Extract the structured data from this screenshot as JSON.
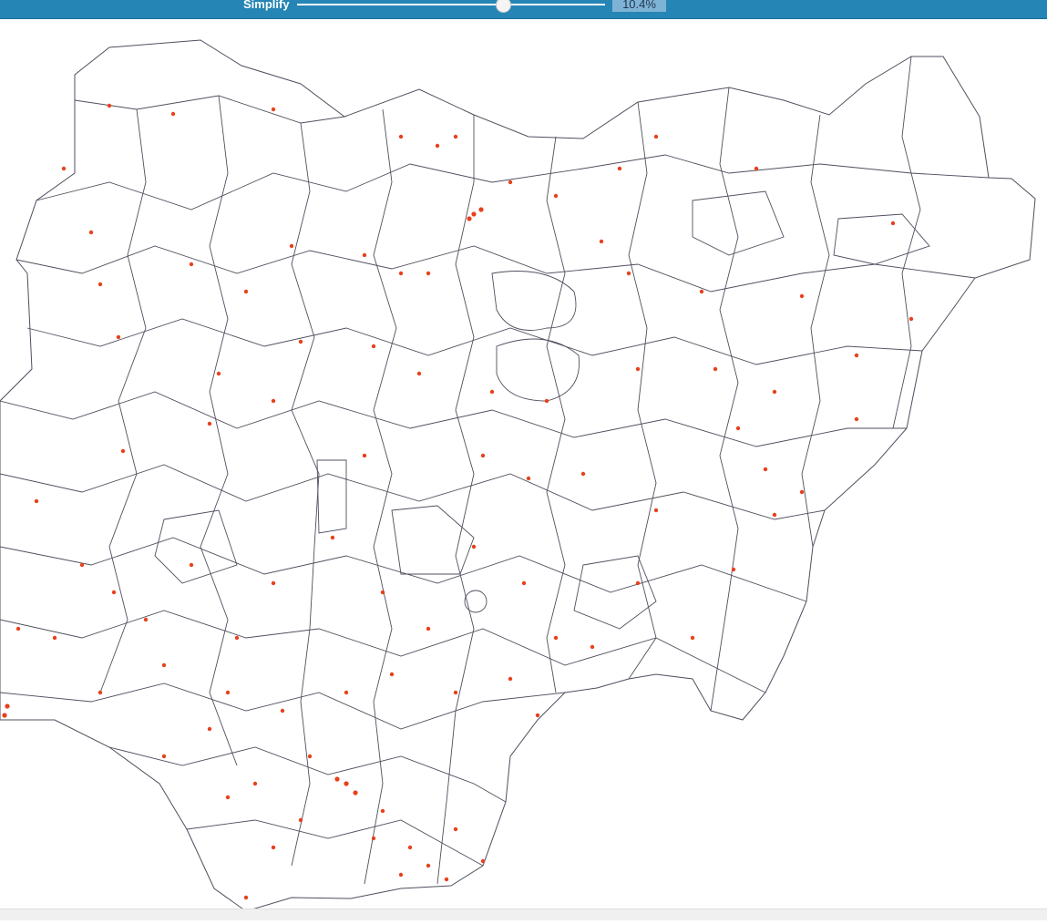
{
  "toolbar": {
    "label": "Simplify",
    "value_text": "10.4%",
    "slider_level": 0.67
  },
  "map": {
    "line_color": "#4f4f5f",
    "vertex_color": "#e8401c",
    "background": "#ffffff"
  }
}
